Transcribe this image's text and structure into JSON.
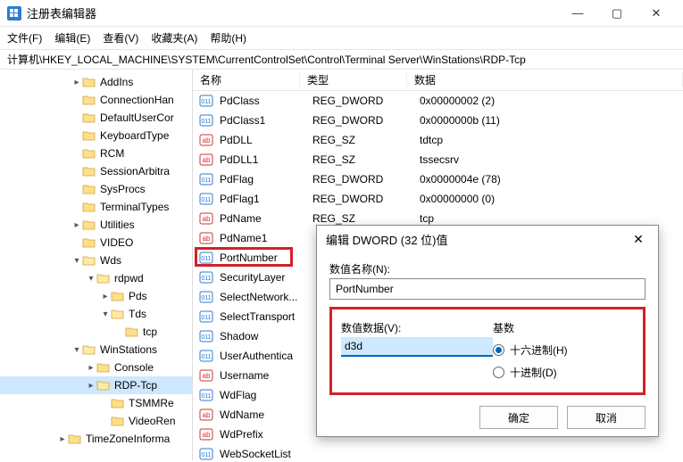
{
  "window": {
    "title": "注册表编辑器"
  },
  "menu": {
    "file": "文件(F)",
    "edit": "编辑(E)",
    "view": "查看(V)",
    "favorites": "收藏夹(A)",
    "help": "帮助(H)"
  },
  "address": "计算机\\HKEY_LOCAL_MACHINE\\SYSTEM\\CurrentControlSet\\Control\\Terminal Server\\WinStations\\RDP-Tcp",
  "tree": [
    {
      "indent": 80,
      "chev": ">",
      "label": "AddIns"
    },
    {
      "indent": 80,
      "chev": "",
      "label": "ConnectionHan"
    },
    {
      "indent": 80,
      "chev": "",
      "label": "DefaultUserCor"
    },
    {
      "indent": 80,
      "chev": "",
      "label": "KeyboardType"
    },
    {
      "indent": 80,
      "chev": "",
      "label": "RCM"
    },
    {
      "indent": 80,
      "chev": "",
      "label": "SessionArbitra"
    },
    {
      "indent": 80,
      "chev": "",
      "label": "SysProcs"
    },
    {
      "indent": 80,
      "chev": "",
      "label": "TerminalTypes"
    },
    {
      "indent": 80,
      "chev": ">",
      "label": "Utilities"
    },
    {
      "indent": 80,
      "chev": "",
      "label": "VIDEO"
    },
    {
      "indent": 80,
      "chev": "v",
      "label": "Wds"
    },
    {
      "indent": 96,
      "chev": "v",
      "label": "rdpwd"
    },
    {
      "indent": 112,
      "chev": ">",
      "label": "Pds"
    },
    {
      "indent": 112,
      "chev": "v",
      "label": "Tds"
    },
    {
      "indent": 128,
      "chev": "",
      "label": "tcp"
    },
    {
      "indent": 80,
      "chev": "v",
      "label": "WinStations"
    },
    {
      "indent": 96,
      "chev": ">",
      "label": "Console"
    },
    {
      "indent": 96,
      "chev": ">",
      "label": "RDP-Tcp",
      "sel": true
    },
    {
      "indent": 112,
      "chev": "",
      "label": "TSMMRe"
    },
    {
      "indent": 112,
      "chev": "",
      "label": "VideoRen"
    },
    {
      "indent": 64,
      "chev": ">",
      "label": "TimeZoneInforma"
    }
  ],
  "columns": {
    "name": "名称",
    "type": "类型",
    "data": "数据"
  },
  "values": [
    {
      "icon": "bin",
      "name": "PdClass",
      "type": "REG_DWORD",
      "data": "0x00000002 (2)"
    },
    {
      "icon": "bin",
      "name": "PdClass1",
      "type": "REG_DWORD",
      "data": "0x0000000b (11)"
    },
    {
      "icon": "str",
      "name": "PdDLL",
      "type": "REG_SZ",
      "data": "tdtcp"
    },
    {
      "icon": "str",
      "name": "PdDLL1",
      "type": "REG_SZ",
      "data": "tssecsrv"
    },
    {
      "icon": "bin",
      "name": "PdFlag",
      "type": "REG_DWORD",
      "data": "0x0000004e (78)"
    },
    {
      "icon": "bin",
      "name": "PdFlag1",
      "type": "REG_DWORD",
      "data": "0x00000000 (0)"
    },
    {
      "icon": "str",
      "name": "PdName",
      "type": "REG_SZ",
      "data": "tcp"
    },
    {
      "icon": "str",
      "name": "PdName1",
      "type": "",
      "data": ""
    },
    {
      "icon": "bin",
      "name": "PortNumber",
      "type": "",
      "data": "",
      "hl": true
    },
    {
      "icon": "bin",
      "name": "SecurityLayer",
      "type": "",
      "data": ""
    },
    {
      "icon": "bin",
      "name": "SelectNetwork...",
      "type": "",
      "data": ""
    },
    {
      "icon": "bin",
      "name": "SelectTransport",
      "type": "",
      "data": ""
    },
    {
      "icon": "bin",
      "name": "Shadow",
      "type": "",
      "data": ""
    },
    {
      "icon": "bin",
      "name": "UserAuthentica",
      "type": "",
      "data": ""
    },
    {
      "icon": "str",
      "name": "Username",
      "type": "",
      "data": ""
    },
    {
      "icon": "bin",
      "name": "WdFlag",
      "type": "",
      "data": ""
    },
    {
      "icon": "str",
      "name": "WdName",
      "type": "",
      "data": ""
    },
    {
      "icon": "str",
      "name": "WdPrefix",
      "type": "",
      "data": ""
    },
    {
      "icon": "bin",
      "name": "WebSocketList",
      "type": "",
      "data": ""
    }
  ],
  "dialog": {
    "title": "编辑 DWORD (32 位)值",
    "name_label": "数值名称(N):",
    "name_value": "PortNumber",
    "data_label": "数值数据(V):",
    "data_value": "d3d",
    "base_label": "基数",
    "hex_label": "十六进制(H)",
    "dec_label": "十进制(D)",
    "ok": "确定",
    "cancel": "取消"
  }
}
